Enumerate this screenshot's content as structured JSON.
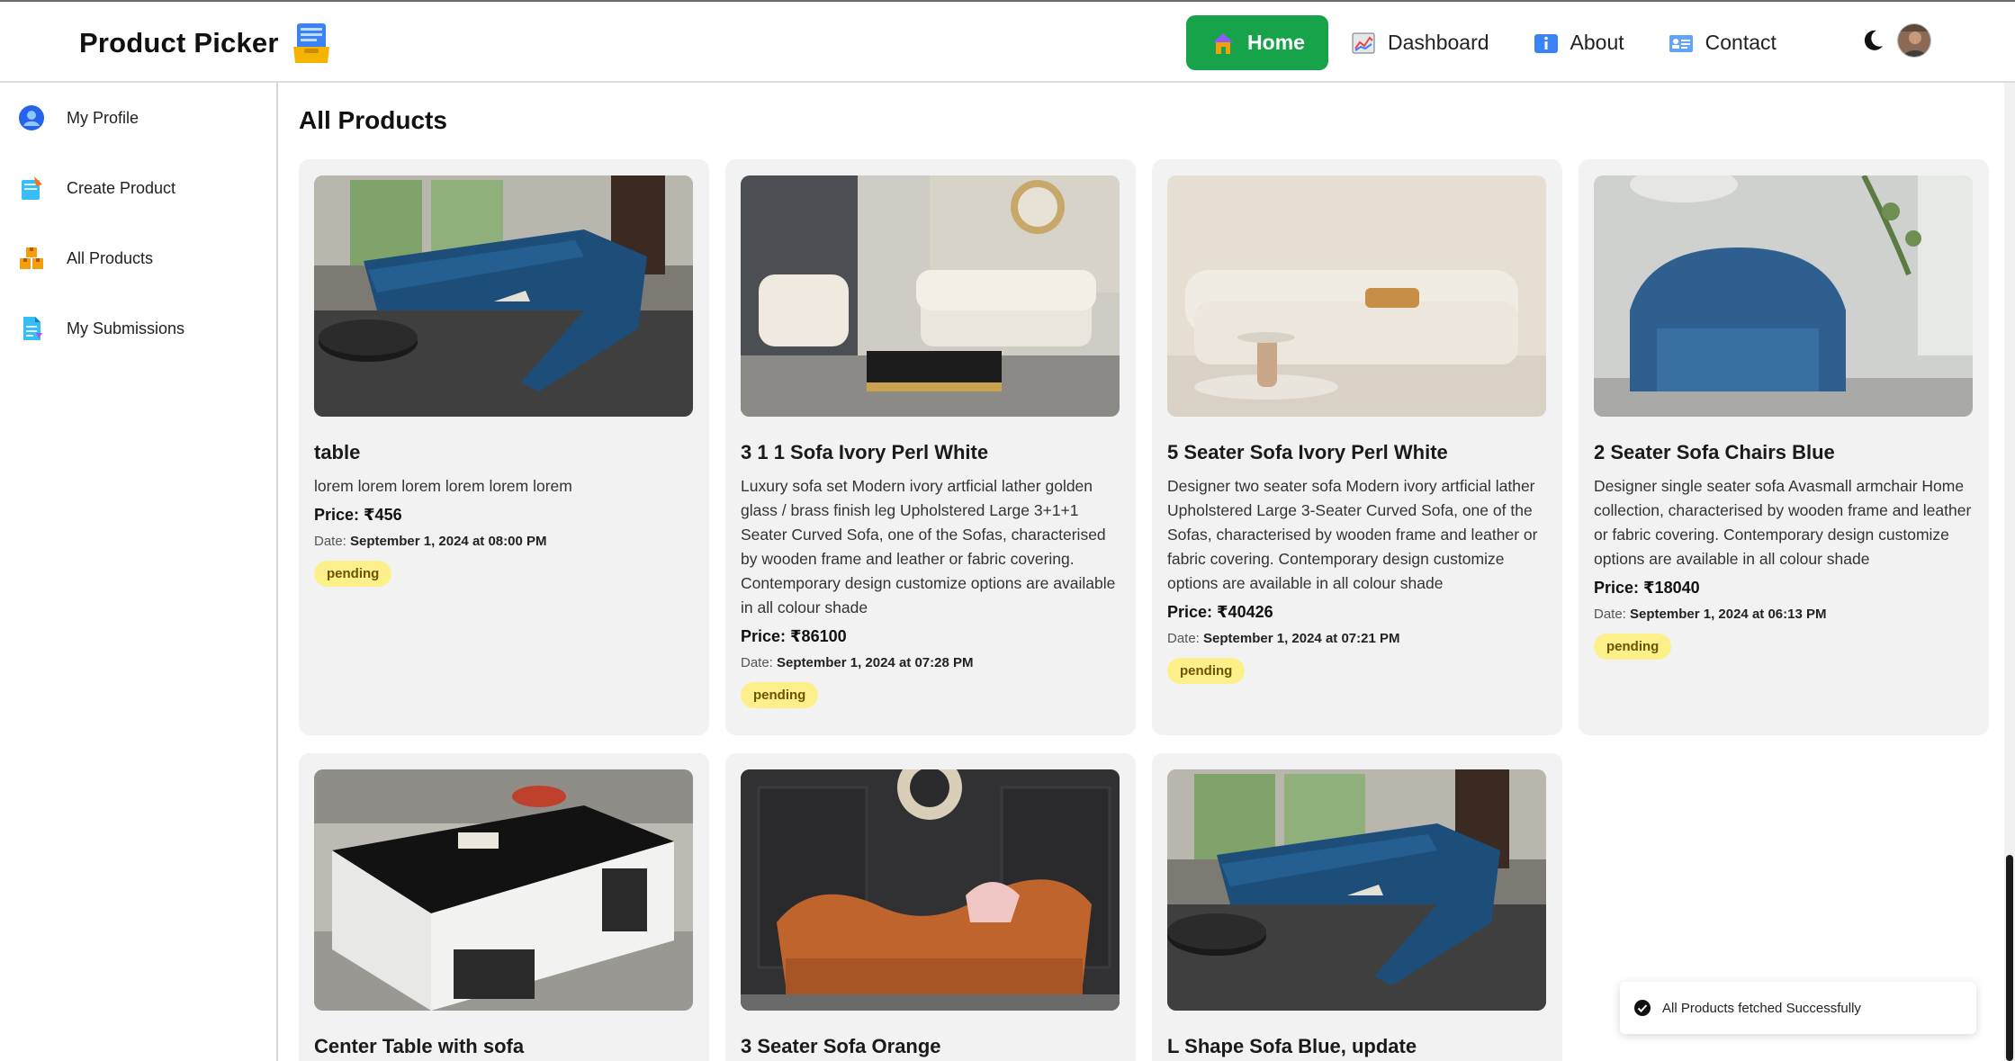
{
  "brand": {
    "name": "Product Picker",
    "logo_icon": "inbox-tray-icon"
  },
  "nav": {
    "items": [
      {
        "label": "Home",
        "icon": "house-icon",
        "active": true
      },
      {
        "label": "Dashboard",
        "icon": "chart-icon",
        "active": false
      },
      {
        "label": "About",
        "icon": "info-icon",
        "active": false
      },
      {
        "label": "Contact",
        "icon": "contact-card-icon",
        "active": false
      }
    ],
    "theme_toggle_icon": "moon-icon",
    "avatar_icon": "user-avatar"
  },
  "sidebar": {
    "items": [
      {
        "label": "My Profile",
        "icon": "profile-icon"
      },
      {
        "label": "Create Product",
        "icon": "create-icon"
      },
      {
        "label": "All Products",
        "icon": "boxes-icon"
      },
      {
        "label": "My Submissions",
        "icon": "document-icon"
      }
    ]
  },
  "main": {
    "title": "All Products",
    "products": [
      {
        "title": "table",
        "description": "lorem lorem lorem lorem lorem lorem",
        "price": "Price: ₹456",
        "date_label": "Date:",
        "date": "September 1, 2024 at 08:00 PM",
        "status": "pending",
        "image": "blue-sectional-sofa"
      },
      {
        "title": "3 1 1 Sofa Ivory Perl White",
        "description": "Luxury sofa set Modern ivory artficial lather golden glass / brass finish leg Upholstered Large 3+1+1 Seater Curved Sofa, one of the Sofas, characterised by wooden frame and leather or fabric covering. Contemporary design customize options are available in all colour shade",
        "price": "Price: ₹86100",
        "date_label": "Date:",
        "date": "September 1, 2024 at 07:28 PM",
        "status": "pending",
        "image": "ivory-sofa-set"
      },
      {
        "title": "5 Seater Sofa Ivory Perl White",
        "description": "Designer two seater sofa Modern ivory artficial lather Upholstered Large 3-Seater Curved Sofa, one of the Sofas, characterised by wooden frame and leather or fabric covering. Contemporary design customize options are available in all colour shade",
        "price": "Price: ₹40426",
        "date_label": "Date:",
        "date": "September 1, 2024 at 07:21 PM",
        "status": "pending",
        "image": "white-sofa"
      },
      {
        "title": "2 Seater Sofa Chairs Blue",
        "description": "Designer single seater sofa Avasmall armchair Home collection, characterised by wooden frame and leather or fabric covering. Contemporary design customize options are available in all colour shade",
        "price": "Price: ₹18040",
        "date_label": "Date:",
        "date": "September 1, 2024 at 06:13 PM",
        "status": "pending",
        "image": "blue-armchair"
      },
      {
        "title": "Center Table with sofa",
        "image": "center-table"
      },
      {
        "title": "3 Seater Sofa Orange",
        "image": "orange-sofa"
      },
      {
        "title": "L Shape Sofa Blue, update",
        "image": "blue-sectional-sofa"
      }
    ]
  },
  "toast": {
    "message": "All Products fetched Successfully",
    "icon": "check-circle-icon"
  },
  "colors": {
    "accent": "#17a34a",
    "badge_bg": "#fdf08a",
    "card_bg": "#f2f2f2"
  }
}
